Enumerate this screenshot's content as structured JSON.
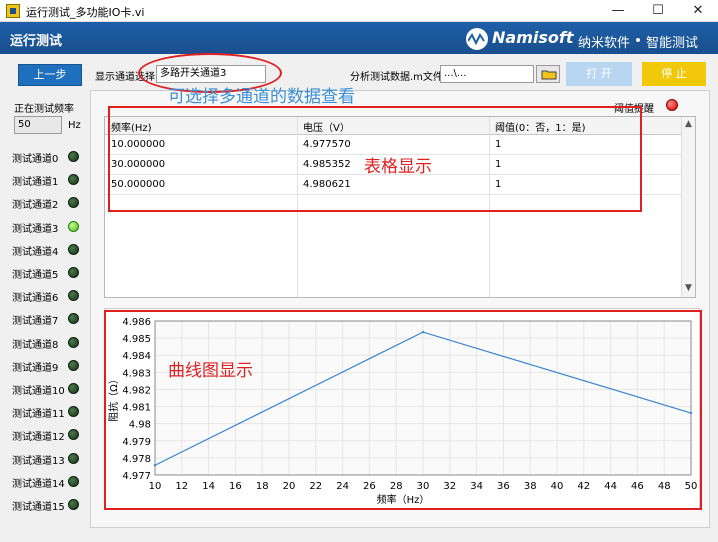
{
  "window": {
    "title": "运行测试_多功能IO卡.vi",
    "controls": [
      "—",
      "☐",
      "✕"
    ]
  },
  "header": {
    "title": "运行测试",
    "brand": "Namisoft",
    "brand_cn": "纳米软件",
    "slogan": "智能测试"
  },
  "toolbar": {
    "back_label": "上一步",
    "channel_select_label": "显示通道选择",
    "channel_select_value": "多路开关通道3",
    "analysis_file_label": "分析测试数据.m文件",
    "analysis_file_value": "...\\...",
    "start_label": "打 开",
    "stop_label": "停 止",
    "start_color": "#b8d6f2",
    "stop_color": "#f2c80a"
  },
  "sidebar": {
    "freq_label": "正在测试频率",
    "freq_value": "50",
    "freq_unit": "Hz",
    "channels": [
      {
        "label": "测试通道0",
        "on": false
      },
      {
        "label": "测试通道1",
        "on": false
      },
      {
        "label": "测试通道2",
        "on": false
      },
      {
        "label": "测试通道3",
        "on": true
      },
      {
        "label": "测试通道4",
        "on": false
      },
      {
        "label": "测试通道5",
        "on": false
      },
      {
        "label": "测试通道6",
        "on": false
      },
      {
        "label": "测试通道7",
        "on": false
      },
      {
        "label": "测试通道8",
        "on": false
      },
      {
        "label": "测试通道9",
        "on": false
      },
      {
        "label": "测试通道10",
        "on": false
      },
      {
        "label": "测试通道11",
        "on": false
      },
      {
        "label": "测试通道12",
        "on": false
      },
      {
        "label": "测试通道13",
        "on": false
      },
      {
        "label": "测试通道14",
        "on": false
      },
      {
        "label": "测试通道15",
        "on": false
      }
    ]
  },
  "alarm": {
    "label": "阈值提醒",
    "color": "#d40000"
  },
  "table": {
    "headers": [
      "频率(Hz)",
      "电压（V）",
      "阈值(0：否，1：是)"
    ],
    "rows": [
      [
        "10.000000",
        "4.977570",
        "1"
      ],
      [
        "30.000000",
        "4.985352",
        "1"
      ],
      [
        "50.000000",
        "4.980621",
        "1"
      ]
    ]
  },
  "annotations": {
    "channel_note": "可选择多通道的数据查看",
    "table_note": "表格显示",
    "chart_note": "曲线图显示"
  },
  "chart_data": {
    "type": "line",
    "xlabel": "频率（Hz）",
    "ylabel": "阻抗（Ω）",
    "xlim": [
      10,
      50
    ],
    "ylim": [
      4.977,
      4.986
    ],
    "x_ticks": [
      10,
      12,
      14,
      16,
      18,
      20,
      22,
      24,
      26,
      28,
      30,
      32,
      34,
      36,
      38,
      40,
      42,
      44,
      46,
      48,
      50
    ],
    "y_ticks": [
      "4.977",
      "4.978",
      "4.979",
      "4.98",
      "4.981",
      "4.982",
      "4.983",
      "4.984",
      "4.985",
      "4.986"
    ],
    "grid": true,
    "series": [
      {
        "x": [
          10,
          30,
          50
        ],
        "values": [
          4.97757,
          4.985352,
          4.980621
        ],
        "color": "#3a84d0"
      }
    ]
  }
}
